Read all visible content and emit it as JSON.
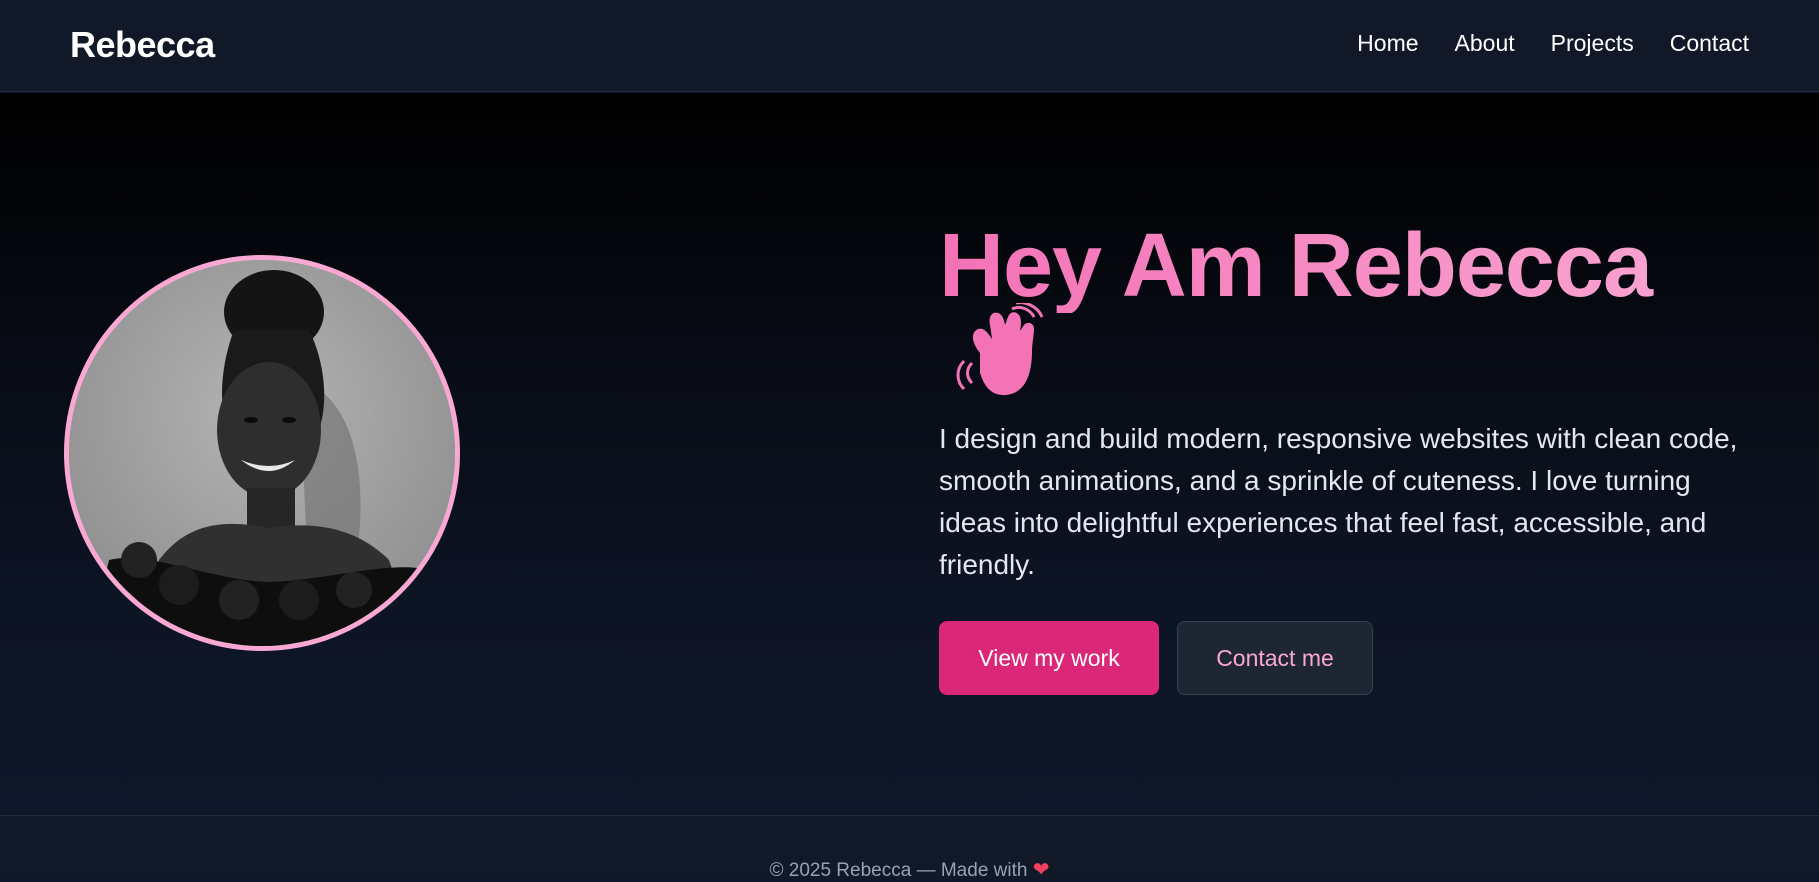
{
  "nav": {
    "brand": "Rebecca",
    "links": [
      "Home",
      "About",
      "Projects",
      "Contact"
    ]
  },
  "hero": {
    "title": "Hey Am Rebecca",
    "wave_icon": "waving-hand-icon",
    "description": "I design and build modern, responsive websites with clean code, smooth animations, and a sprinkle of cuteness. I love turning ideas into delightful experiences that feel fast, accessible, and friendly.",
    "primary_button": "View my work",
    "secondary_button": "Contact me",
    "avatar_icon": "profile-photo"
  },
  "footer": {
    "text": "© 2025 Rebecca — Made with",
    "heart": "❤"
  },
  "colors": {
    "accent": "#db2777",
    "accent_light": "#f472b6",
    "avatar_border": "#f9a8d4",
    "background": "#0f172a",
    "navbar": "#111827"
  }
}
